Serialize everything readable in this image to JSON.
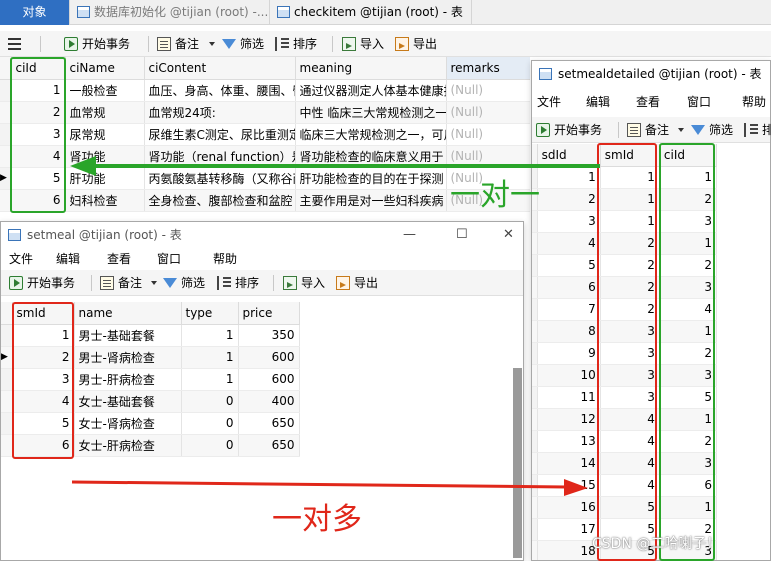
{
  "tabs": [
    {
      "label": "对象",
      "active": true
    },
    {
      "label": "数据库初始化 @tijian (root) -...",
      "active": false
    },
    {
      "label": "checkitem @tijian (root) - 表",
      "active": false
    }
  ],
  "main_toolbar": {
    "start_tx": "开始事务",
    "note": "备注",
    "filter": "筛选",
    "sort": "排序",
    "import": "导入",
    "export": "导出"
  },
  "checkitem": {
    "columns": [
      "ciId",
      "ciName",
      "ciContent",
      "meaning",
      "remarks"
    ],
    "rows": [
      [
        "1",
        "一般检查",
        "血压、身高、体重、腰围、臀",
        "通过仪器测定人体基本健康指",
        "(Null)"
      ],
      [
        "2",
        "血常规",
        "血常规24项:",
        "中性 临床三大常规检测之一，是",
        "(Null)"
      ],
      [
        "3",
        "尿常规",
        "尿维生素C测定、尿比重测定",
        "临床三大常规检测之一，可反",
        "(Null)"
      ],
      [
        "4",
        "肾功能",
        "肾功能（renal function）是",
        "肾功能检查的临床意义用于",
        "(Null)"
      ],
      [
        "5",
        "肝功能",
        "丙氨酸氨基转移酶（又称谷丙",
        "肝功能检查的目的在于探测",
        "(Null)"
      ],
      [
        "6",
        "妇科检查",
        "全身检查、腹部检查和盆腔",
        "主要作用是对一些妇科疾病",
        "(Null)"
      ]
    ]
  },
  "setmeal_window": {
    "title": "setmeal @tijian (root) - 表",
    "menu": [
      "文件",
      "编辑",
      "查看",
      "窗口",
      "帮助"
    ],
    "columns": [
      "smId",
      "name",
      "type",
      "price"
    ],
    "rows": [
      [
        "1",
        "男士-基础套餐",
        "1",
        "350"
      ],
      [
        "2",
        "男士-肾病检查",
        "1",
        "600"
      ],
      [
        "3",
        "男士-肝病检查",
        "1",
        "600"
      ],
      [
        "4",
        "女士-基础套餐",
        "0",
        "400"
      ],
      [
        "5",
        "女士-肾病检查",
        "0",
        "650"
      ],
      [
        "6",
        "女士-肝病检查",
        "0",
        "650"
      ]
    ]
  },
  "detail_window": {
    "title": "setmealdetailed @tijian (root) - 表",
    "menu": [
      "文件",
      "编辑",
      "查看",
      "窗口",
      "帮助"
    ],
    "columns": [
      "sdId",
      "smId",
      "ciId"
    ],
    "rows": [
      [
        "1",
        "1",
        "1"
      ],
      [
        "2",
        "1",
        "2"
      ],
      [
        "3",
        "1",
        "3"
      ],
      [
        "4",
        "2",
        "1"
      ],
      [
        "5",
        "2",
        "2"
      ],
      [
        "6",
        "2",
        "3"
      ],
      [
        "7",
        "2",
        "4"
      ],
      [
        "8",
        "3",
        "1"
      ],
      [
        "9",
        "3",
        "2"
      ],
      [
        "10",
        "3",
        "3"
      ],
      [
        "11",
        "3",
        "5"
      ],
      [
        "12",
        "4",
        "1"
      ],
      [
        "13",
        "4",
        "2"
      ],
      [
        "14",
        "4",
        "3"
      ],
      [
        "15",
        "4",
        "6"
      ],
      [
        "16",
        "5",
        "1"
      ],
      [
        "17",
        "5",
        "2"
      ],
      [
        "18",
        "5",
        "3"
      ]
    ]
  },
  "annotations": {
    "one_to_one": "一对一",
    "one_to_many": "一对多",
    "watermark": "CSDN @二哈喇子！"
  },
  "colors": {
    "green": "#2aa52a",
    "red": "#e0271a",
    "tab_active": "#2f6fc2"
  }
}
